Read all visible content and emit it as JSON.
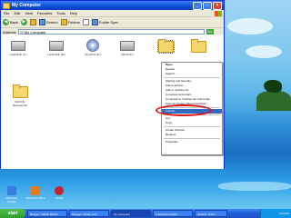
{
  "window": {
    "title": "My Computer",
    "menu": [
      "File",
      "Edit",
      "View",
      "Favorites",
      "Tools",
      "Help"
    ],
    "toolbar": {
      "back": "Back",
      "search": "Search",
      "folders": "Folders",
      "folder_sync": "Folder Sync"
    },
    "address": {
      "label": "Address",
      "value": "My Computer",
      "go": "Go"
    }
  },
  "items": [
    {
      "label": "Local Disk (C:)",
      "icon": "hard-drive-icon"
    },
    {
      "label": "Local Disk (D:)",
      "icon": "hard-drive-icon"
    },
    {
      "label": "CD Drive (E:)",
      "icon": "cd-drive-icon"
    },
    {
      "label": "CRUZ (F:)",
      "icon": "removable-drive-icon"
    },
    {
      "label": "",
      "icon": "folder-icon"
    },
    {
      "label": "",
      "icon": "folder-icon"
    },
    {
      "label": "Dell (My Documents)",
      "icon": "folder-icon"
    }
  ],
  "context_menu": {
    "items": [
      {
        "label": "Open",
        "bold": true
      },
      {
        "label": "Explore"
      },
      {
        "label": "Search..."
      },
      {
        "sep": true
      },
      {
        "label": "Sharing and Security..."
      },
      {
        "label": "Add to archive..."
      },
      {
        "label": "Add to \"Archive.rar\""
      },
      {
        "label": "Compress and email..."
      },
      {
        "label": "Compress to \"Archive.rar\" and email"
      },
      {
        "label": "Scan for viruses (Recommended)"
      },
      {
        "sep": true
      },
      {
        "label": "Format...",
        "highlighted": true
      },
      {
        "sep": true
      },
      {
        "label": "Cut"
      },
      {
        "label": "Copy"
      },
      {
        "sep": true
      },
      {
        "label": "Create Shortcut"
      },
      {
        "label": "Rename"
      },
      {
        "sep": true
      },
      {
        "label": "Properties"
      }
    ]
  },
  "desktop_icons": [
    {
      "label": "Windows Update",
      "icon": "windows-update-icon"
    },
    {
      "label": "Microsoft Office",
      "icon": "office-icon"
    },
    {
      "label": "Media",
      "icon": "media-icon"
    }
  ],
  "taskbar": {
    "start": "start",
    "tasks": [
      {
        "label": "Blogger: INDAB BILAN...",
        "active": false
      },
      {
        "label": "Blogger: Create post...",
        "active": false
      },
      {
        "label": "My Computer",
        "active": true
      },
      {
        "label": "2 Windows Media...",
        "active": false
      },
      {
        "label": "untitled - Paint",
        "active": false
      }
    ],
    "clock": "4:24 PM"
  },
  "colors": {
    "titlebar": "#0a4ed6",
    "selection": "#316ac5",
    "annotation": "#e01414",
    "taskbar": "#245edb",
    "start": "#2d9f2a"
  }
}
